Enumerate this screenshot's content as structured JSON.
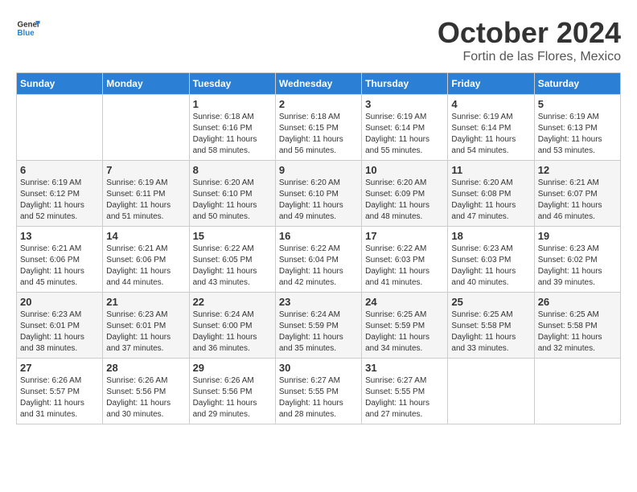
{
  "logo": {
    "line1": "General",
    "line2": "Blue"
  },
  "title": "October 2024",
  "subtitle": "Fortin de las Flores, Mexico",
  "days_of_week": [
    "Sunday",
    "Monday",
    "Tuesday",
    "Wednesday",
    "Thursday",
    "Friday",
    "Saturday"
  ],
  "weeks": [
    [
      {
        "day": "",
        "info": ""
      },
      {
        "day": "",
        "info": ""
      },
      {
        "day": "1",
        "info": "Sunrise: 6:18 AM\nSunset: 6:16 PM\nDaylight: 11 hours\nand 58 minutes."
      },
      {
        "day": "2",
        "info": "Sunrise: 6:18 AM\nSunset: 6:15 PM\nDaylight: 11 hours\nand 56 minutes."
      },
      {
        "day": "3",
        "info": "Sunrise: 6:19 AM\nSunset: 6:14 PM\nDaylight: 11 hours\nand 55 minutes."
      },
      {
        "day": "4",
        "info": "Sunrise: 6:19 AM\nSunset: 6:14 PM\nDaylight: 11 hours\nand 54 minutes."
      },
      {
        "day": "5",
        "info": "Sunrise: 6:19 AM\nSunset: 6:13 PM\nDaylight: 11 hours\nand 53 minutes."
      }
    ],
    [
      {
        "day": "6",
        "info": "Sunrise: 6:19 AM\nSunset: 6:12 PM\nDaylight: 11 hours\nand 52 minutes."
      },
      {
        "day": "7",
        "info": "Sunrise: 6:19 AM\nSunset: 6:11 PM\nDaylight: 11 hours\nand 51 minutes."
      },
      {
        "day": "8",
        "info": "Sunrise: 6:20 AM\nSunset: 6:10 PM\nDaylight: 11 hours\nand 50 minutes."
      },
      {
        "day": "9",
        "info": "Sunrise: 6:20 AM\nSunset: 6:10 PM\nDaylight: 11 hours\nand 49 minutes."
      },
      {
        "day": "10",
        "info": "Sunrise: 6:20 AM\nSunset: 6:09 PM\nDaylight: 11 hours\nand 48 minutes."
      },
      {
        "day": "11",
        "info": "Sunrise: 6:20 AM\nSunset: 6:08 PM\nDaylight: 11 hours\nand 47 minutes."
      },
      {
        "day": "12",
        "info": "Sunrise: 6:21 AM\nSunset: 6:07 PM\nDaylight: 11 hours\nand 46 minutes."
      }
    ],
    [
      {
        "day": "13",
        "info": "Sunrise: 6:21 AM\nSunset: 6:06 PM\nDaylight: 11 hours\nand 45 minutes."
      },
      {
        "day": "14",
        "info": "Sunrise: 6:21 AM\nSunset: 6:06 PM\nDaylight: 11 hours\nand 44 minutes."
      },
      {
        "day": "15",
        "info": "Sunrise: 6:22 AM\nSunset: 6:05 PM\nDaylight: 11 hours\nand 43 minutes."
      },
      {
        "day": "16",
        "info": "Sunrise: 6:22 AM\nSunset: 6:04 PM\nDaylight: 11 hours\nand 42 minutes."
      },
      {
        "day": "17",
        "info": "Sunrise: 6:22 AM\nSunset: 6:03 PM\nDaylight: 11 hours\nand 41 minutes."
      },
      {
        "day": "18",
        "info": "Sunrise: 6:23 AM\nSunset: 6:03 PM\nDaylight: 11 hours\nand 40 minutes."
      },
      {
        "day": "19",
        "info": "Sunrise: 6:23 AM\nSunset: 6:02 PM\nDaylight: 11 hours\nand 39 minutes."
      }
    ],
    [
      {
        "day": "20",
        "info": "Sunrise: 6:23 AM\nSunset: 6:01 PM\nDaylight: 11 hours\nand 38 minutes."
      },
      {
        "day": "21",
        "info": "Sunrise: 6:23 AM\nSunset: 6:01 PM\nDaylight: 11 hours\nand 37 minutes."
      },
      {
        "day": "22",
        "info": "Sunrise: 6:24 AM\nSunset: 6:00 PM\nDaylight: 11 hours\nand 36 minutes."
      },
      {
        "day": "23",
        "info": "Sunrise: 6:24 AM\nSunset: 5:59 PM\nDaylight: 11 hours\nand 35 minutes."
      },
      {
        "day": "24",
        "info": "Sunrise: 6:25 AM\nSunset: 5:59 PM\nDaylight: 11 hours\nand 34 minutes."
      },
      {
        "day": "25",
        "info": "Sunrise: 6:25 AM\nSunset: 5:58 PM\nDaylight: 11 hours\nand 33 minutes."
      },
      {
        "day": "26",
        "info": "Sunrise: 6:25 AM\nSunset: 5:58 PM\nDaylight: 11 hours\nand 32 minutes."
      }
    ],
    [
      {
        "day": "27",
        "info": "Sunrise: 6:26 AM\nSunset: 5:57 PM\nDaylight: 11 hours\nand 31 minutes."
      },
      {
        "day": "28",
        "info": "Sunrise: 6:26 AM\nSunset: 5:56 PM\nDaylight: 11 hours\nand 30 minutes."
      },
      {
        "day": "29",
        "info": "Sunrise: 6:26 AM\nSunset: 5:56 PM\nDaylight: 11 hours\nand 29 minutes."
      },
      {
        "day": "30",
        "info": "Sunrise: 6:27 AM\nSunset: 5:55 PM\nDaylight: 11 hours\nand 28 minutes."
      },
      {
        "day": "31",
        "info": "Sunrise: 6:27 AM\nSunset: 5:55 PM\nDaylight: 11 hours\nand 27 minutes."
      },
      {
        "day": "",
        "info": ""
      },
      {
        "day": "",
        "info": ""
      }
    ]
  ]
}
